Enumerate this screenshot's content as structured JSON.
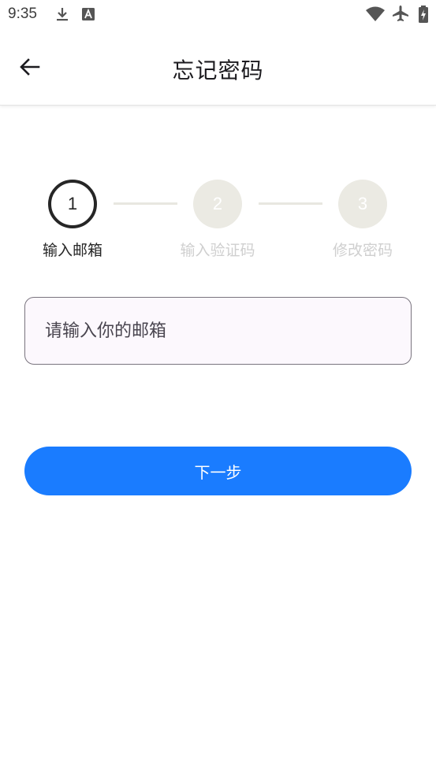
{
  "status_bar": {
    "time": "9:35",
    "icons_left": [
      "download-icon",
      "app-a-icon"
    ],
    "icons_right": [
      "wifi-icon",
      "airplane-icon",
      "battery-charging-icon"
    ]
  },
  "app_bar": {
    "title": "忘记密码",
    "back_icon": "arrow-back-icon"
  },
  "stepper": {
    "steps": [
      {
        "number": "1",
        "label": "输入邮箱",
        "state": "active"
      },
      {
        "number": "2",
        "label": "输入验证码",
        "state": "inactive"
      },
      {
        "number": "3",
        "label": "修改密码",
        "state": "inactive"
      }
    ]
  },
  "form": {
    "email_placeholder": "请输入你的邮箱",
    "email_value": ""
  },
  "actions": {
    "next_label": "下一步"
  },
  "colors": {
    "primary": "#1a7cff",
    "step_active": "#262626",
    "step_inactive": "#ebeae3",
    "field_background": "#fcf8fd"
  }
}
